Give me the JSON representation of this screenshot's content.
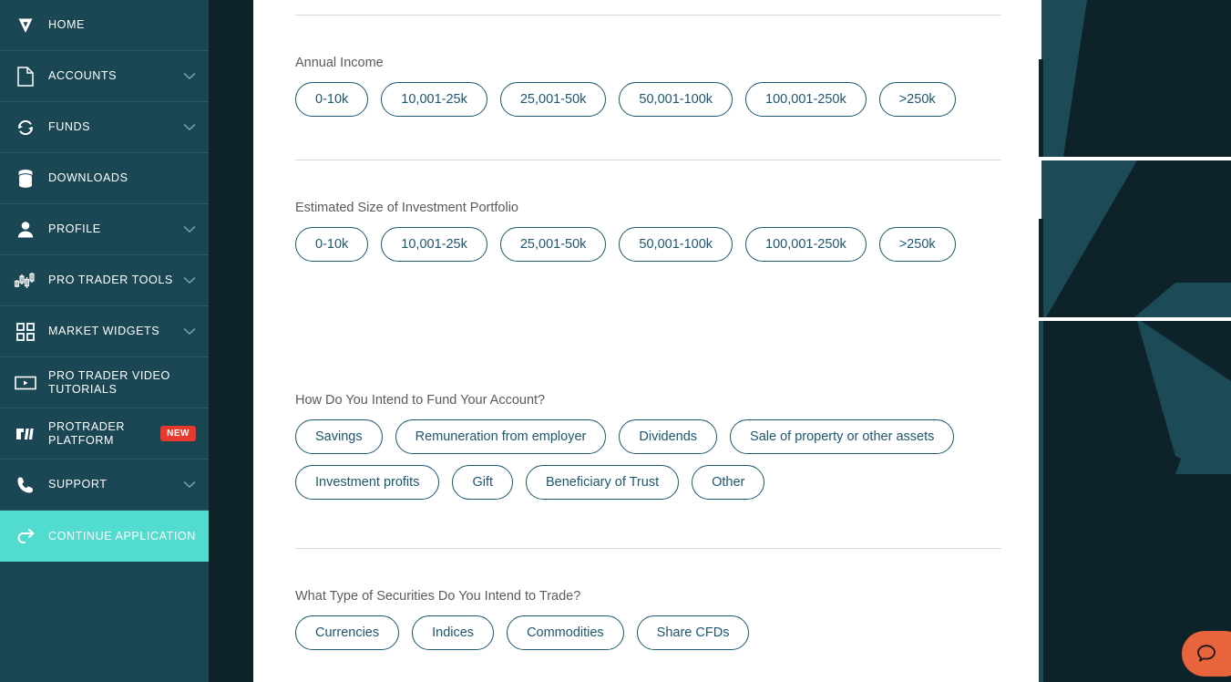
{
  "sidebar": {
    "items": [
      {
        "label": "HOME",
        "icon": "logo-v-icon",
        "chevron": false,
        "badge": null,
        "active": false
      },
      {
        "label": "ACCOUNTS",
        "icon": "document-icon",
        "chevron": true,
        "badge": null,
        "active": false
      },
      {
        "label": "FUNDS",
        "icon": "refresh-circle-icon",
        "chevron": true,
        "badge": null,
        "active": false
      },
      {
        "label": "DOWNLOADS",
        "icon": "database-icon",
        "chevron": false,
        "badge": null,
        "active": false
      },
      {
        "label": "PROFILE",
        "icon": "user-icon",
        "chevron": true,
        "badge": null,
        "active": false
      },
      {
        "label": "PRO TRADER TOOLS",
        "icon": "candlestick-chart-icon",
        "chevron": true,
        "badge": null,
        "active": false
      },
      {
        "label": "MARKET WIDGETS",
        "icon": "grid-squares-icon",
        "chevron": true,
        "badge": null,
        "active": false
      },
      {
        "label": "PRO TRADER VIDEO TUTORIALS",
        "icon": "video-player-icon",
        "chevron": false,
        "badge": null,
        "active": false
      },
      {
        "label": "PROTRADER PLATFORM",
        "icon": "protrader-logo-icon",
        "chevron": false,
        "badge": "NEW",
        "active": false
      },
      {
        "label": "SUPPORT",
        "icon": "phone-icon",
        "chevron": true,
        "badge": null,
        "active": false
      },
      {
        "label": "CONTINUE APPLICATION",
        "icon": "arrow-forward-curve-icon",
        "chevron": false,
        "badge": null,
        "active": true
      }
    ],
    "colors": {
      "background": "#1b4654",
      "backdrop": "#0d2329",
      "active_background": "#52dcd0",
      "badge_background": "#e8392e",
      "text": "#ffffff",
      "divider": "#27596a"
    }
  },
  "form": {
    "sections": [
      {
        "label": "Annual Income",
        "options": [
          "0-10k",
          "10,001-25k",
          "25,001-50k",
          "50,001-100k",
          "100,001-250k",
          ">250k"
        ]
      },
      {
        "label": "Estimated Size of Investment Portfolio",
        "options": [
          "0-10k",
          "10,001-25k",
          "25,001-50k",
          "50,001-100k",
          "100,001-250k",
          ">250k"
        ]
      },
      {
        "label": "How Do You Intend to Fund Your Account?",
        "options": [
          "Savings",
          "Remuneration from employer",
          "Dividends",
          "Sale of property or other assets",
          "Investment profits",
          "Gift",
          "Beneficiary of Trust",
          "Other"
        ]
      },
      {
        "label": "What Type of Securities Do You Intend to Trade?",
        "options": [
          "Currencies",
          "Indices",
          "Commodities",
          "Share CFDs"
        ]
      }
    ],
    "colors": {
      "chip_border": "#1d5670",
      "chip_text": "#1d5670",
      "label_text": "#585b5e",
      "divider": "#d8dadc"
    }
  },
  "chat": {
    "icon": "chat-bubble-icon",
    "color": "#e8643c"
  },
  "decoration": {
    "teal": "#1d4a57",
    "dark": "#0d2329"
  }
}
